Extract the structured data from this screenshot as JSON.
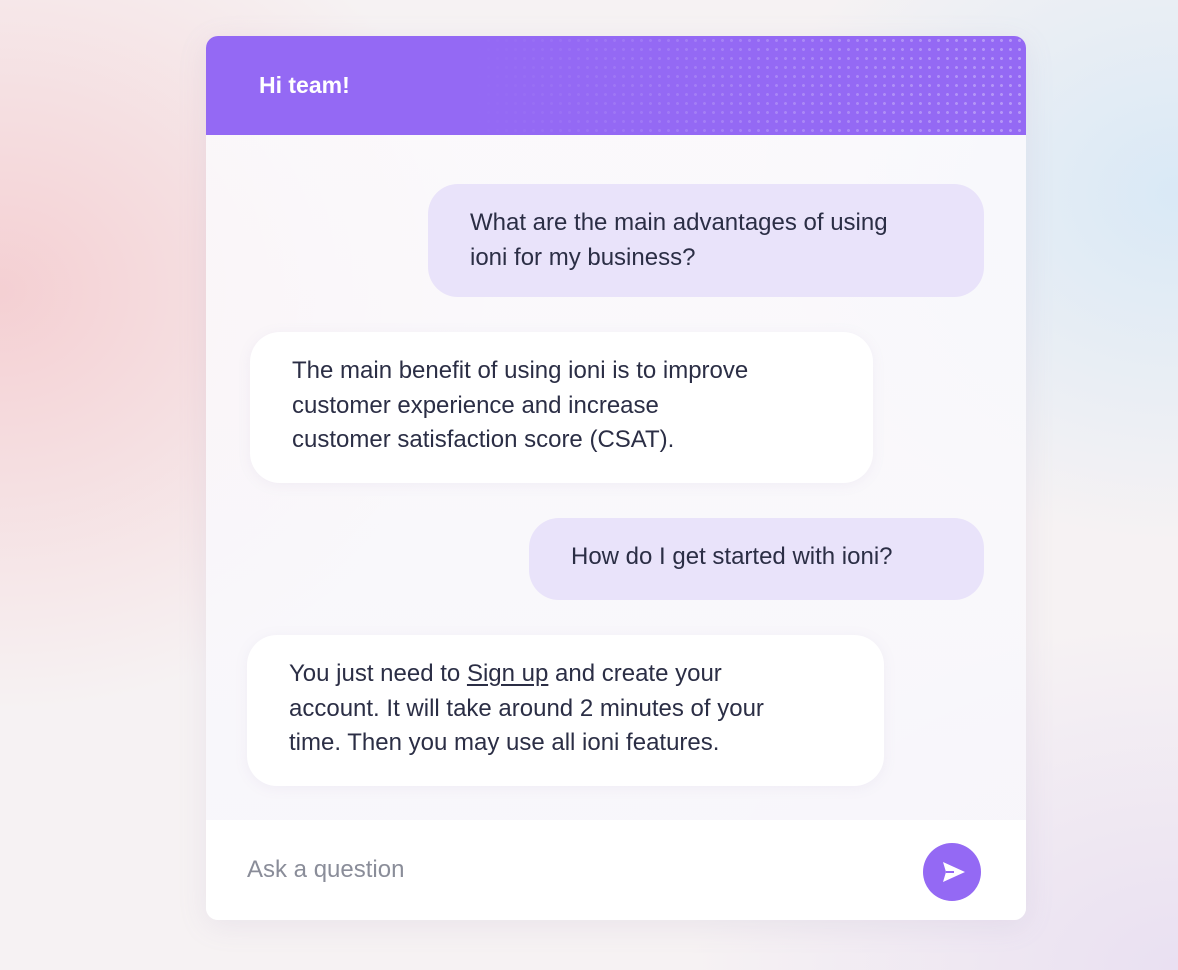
{
  "header": {
    "title": "Hi team!",
    "color": "#9469f4"
  },
  "messages": [
    {
      "role": "user",
      "text": "What are the main advantages of using ioni for my business?",
      "lines": [
        "What are the main advantages of using",
        "ioni for my business?"
      ]
    },
    {
      "role": "bot",
      "text": "The main benefit of using ioni is to improve customer experience and increase customer satisfaction score (CSAT).",
      "lines": [
        "The main benefit of using ioni is to improve",
        "customer experience and increase",
        "customer satisfaction score (CSAT)."
      ]
    },
    {
      "role": "user",
      "text": "How do I get started with ioni?"
    },
    {
      "role": "bot",
      "text_before_link": "You just need to ",
      "link_text": "Sign up",
      "text_after_link": " and create your",
      "lines_after": [
        "account. It will take around 2 minutes of your",
        "time. Then you may use all ioni features."
      ]
    }
  ],
  "composer": {
    "placeholder": "Ask a question",
    "value": "",
    "send_icon": "send-arrow-icon"
  },
  "colors": {
    "accent": "#9469f4",
    "user_bubble": "#e9e3fa",
    "bot_bubble": "#ffffff",
    "text": "#2b2e45"
  }
}
